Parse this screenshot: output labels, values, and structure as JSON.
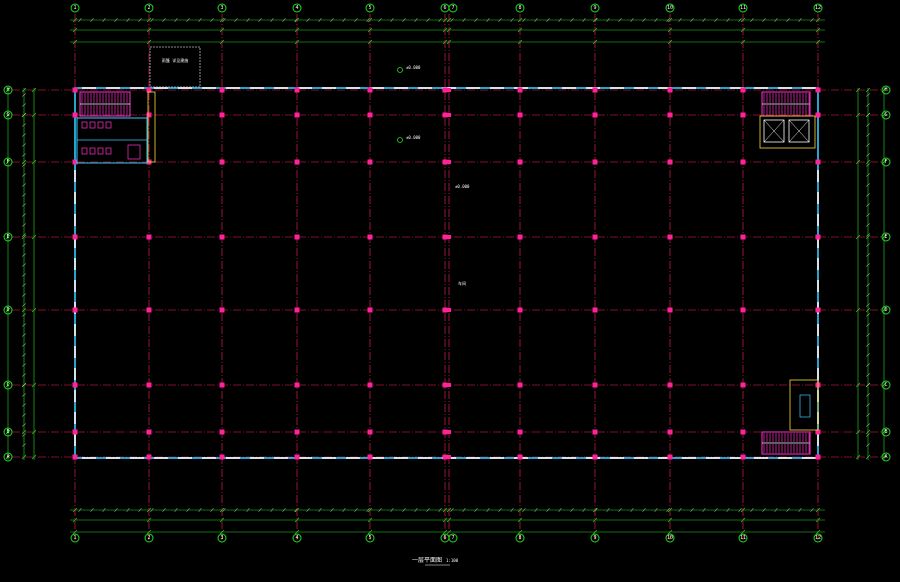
{
  "drawing": {
    "title": "一层平面图",
    "scale": "1:100",
    "colors": {
      "background": "#000000",
      "axis": "#ff2255",
      "column": "#ff2299",
      "wall": "#33ccff",
      "dimension": "#22dd22",
      "stair": "#ff33cc",
      "window": "#ffdd33"
    }
  },
  "axes": {
    "vertical": [
      "1",
      "2",
      "3",
      "4",
      "5",
      "6",
      "7",
      "8",
      "9",
      "10",
      "11",
      "12"
    ],
    "horizontal": [
      "H",
      "G",
      "F",
      "E",
      "D",
      "C",
      "B",
      "A"
    ]
  },
  "annotations": {
    "canopy": "雨篷 详见建施",
    "elev1": "±0.000",
    "elev2": "±0.000",
    "center_note": "±0.000",
    "floor_note": "车间"
  }
}
